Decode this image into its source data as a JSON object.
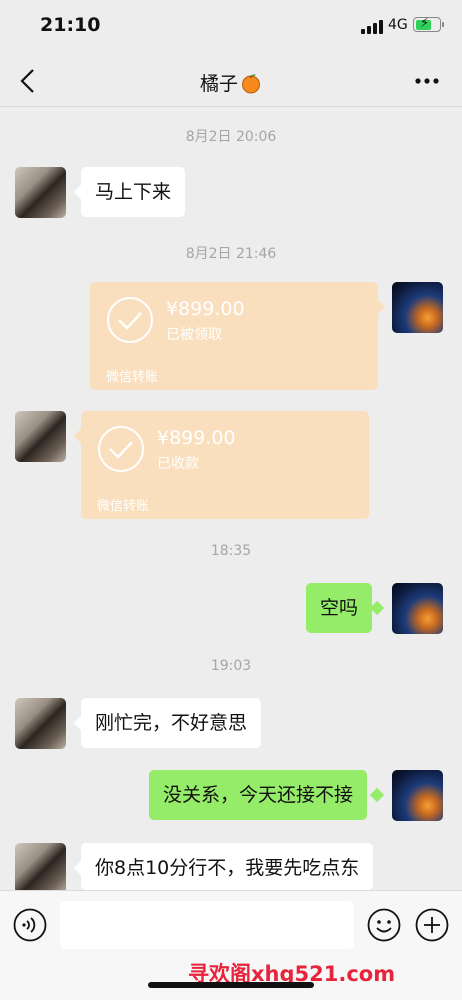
{
  "status_bar": {
    "time": "21:10",
    "network": "4G"
  },
  "nav": {
    "title": "橘子"
  },
  "messages": {
    "t1": "8月2日 20:06",
    "m1": "马上下来",
    "t2": "8月2日 21:46",
    "transfer_sent": {
      "amount": "¥899.00",
      "status": "已被领取",
      "footer": "微信转账"
    },
    "transfer_received": {
      "amount": "¥899.00",
      "status": "已收款",
      "footer": "微信转账"
    },
    "t3": "18:35",
    "m2": "空吗",
    "t4": "19:03",
    "m3": "刚忙完，不好意思",
    "m4": "没关系，今天还接不接",
    "m5": "你8点10分行不，我要先吃点东"
  },
  "input": {
    "placeholder": ""
  },
  "watermark": "寻欢阁xhg521.com",
  "colors": {
    "background": "#ededed",
    "sent_bubble": "#95ec69",
    "received_bubble": "#ffffff",
    "transfer_card": "#f9dfbd",
    "watermark": "#e8243c"
  }
}
